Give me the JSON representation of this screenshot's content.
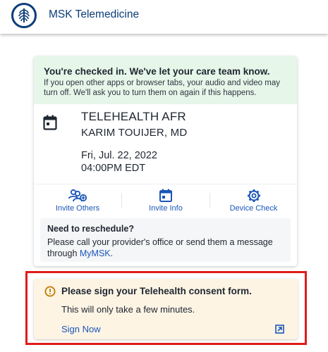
{
  "header": {
    "app_title": "MSK Telemedicine",
    "logo_icon": "msk-logo-icon",
    "brand_color": "#0b3c7a"
  },
  "checkin": {
    "title": "You're checked in. We've let your care team know.",
    "message": "If you open other apps or browser tabs, your audio and video may turn off. We'll ask you to turn them on again if this happens.",
    "background": "#e6f6e9"
  },
  "appointment": {
    "icon": "calendar-icon",
    "type": "TELEHEALTH AFR",
    "provider": "KARIM TOUIJER, MD",
    "date": "Fri, Jul. 22, 2022",
    "time": "04:00PM EDT"
  },
  "actions": [
    {
      "label": "Invite Others",
      "icon": "invite-people-icon"
    },
    {
      "label": "Invite Info",
      "icon": "calendar-info-icon"
    },
    {
      "label": "Device Check",
      "icon": "gear-icon"
    }
  ],
  "reschedule": {
    "title": "Need to reschedule?",
    "text": "Please call your provider's office or send them a message through",
    "link_label": "MyMSK",
    "suffix": "."
  },
  "consent": {
    "title": "Please sign your Telehealth consent form.",
    "text": "This will only take a few minutes.",
    "action_label": "Sign Now",
    "icon": "warning-icon",
    "open_icon": "external-link-icon",
    "background": "#fdf4e4"
  },
  "colors": {
    "link": "#1a56b8",
    "highlight_border": "#e01b1b"
  }
}
